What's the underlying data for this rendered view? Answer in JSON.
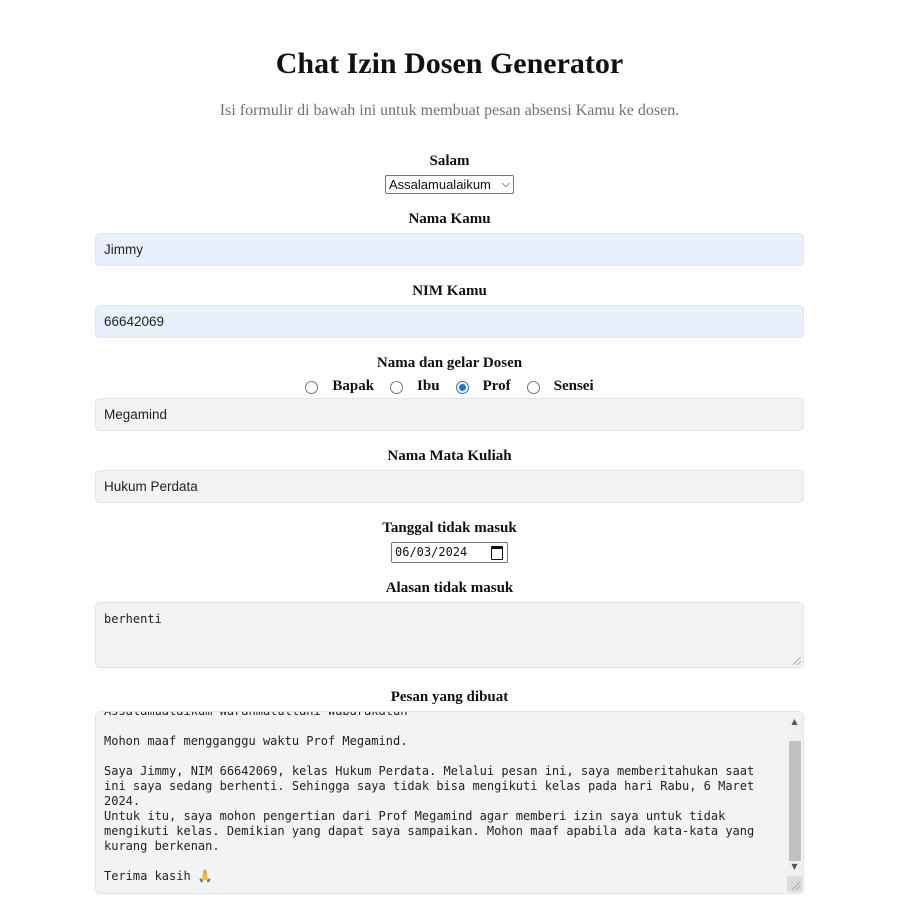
{
  "header": {
    "title": "Chat Izin Dosen Generator",
    "subtitle": "Isi formulir di bawah ini untuk membuat pesan absensi Kamu ke dosen."
  },
  "form": {
    "salam": {
      "label": "Salam",
      "value": "Assalamualaikum"
    },
    "nama": {
      "label": "Nama Kamu",
      "value": "Jimmy"
    },
    "nim": {
      "label": "NIM Kamu",
      "value": "66642069"
    },
    "dosen": {
      "label": "Nama dan gelar Dosen",
      "options": [
        "Bapak",
        "Ibu",
        "Prof",
        "Sensei"
      ],
      "selected": "Prof",
      "value": "Megamind"
    },
    "matkul": {
      "label": "Nama Mata Kuliah",
      "value": "Hukum Perdata"
    },
    "tanggal": {
      "label": "Tanggal tidak masuk",
      "value": "06/03/2024"
    },
    "alasan": {
      "label": "Alasan tidak masuk",
      "value": "berhenti"
    },
    "pesan": {
      "label": "Pesan yang dibuat",
      "value": "Assalamualaikum Warahmatullahi Wabarakatuh\n\nMohon maaf mengganggu waktu Prof Megamind.\n\nSaya Jimmy, NIM 66642069, kelas Hukum Perdata. Melalui pesan ini, saya memberitahukan saat ini saya sedang berhenti. Sehingga saya tidak bisa mengikuti kelas pada hari Rabu, 6 Maret 2024.\nUntuk itu, saya mohon pengertian dari Prof Megamind agar memberi izin saya untuk tidak mengikuti kelas. Demikian yang dapat saya sampaikan. Mohon maaf apabila ada kata-kata yang kurang berkenan.\n\nTerima kasih 🙏"
    }
  },
  "colors": {
    "autofill": "#e8f0fe",
    "field": "#f2f3f5",
    "subtitle": "#6b7280",
    "radio_checked": "#1a73e8"
  }
}
